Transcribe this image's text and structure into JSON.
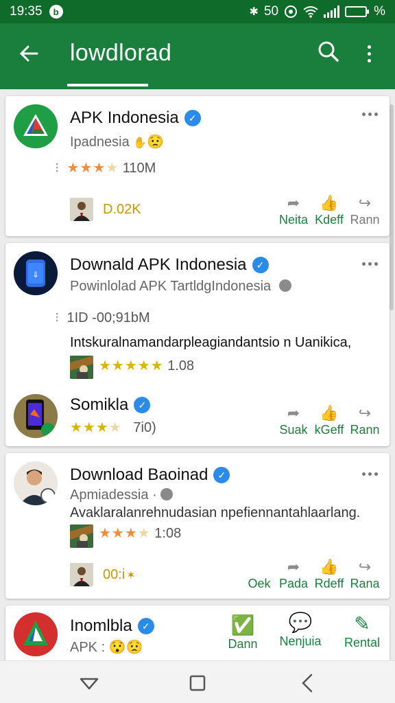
{
  "status": {
    "time": "19:35",
    "notif_icon": "b",
    "percent_num": "50",
    "battery": "%"
  },
  "appbar": {
    "title": "lowdlorad"
  },
  "cards": [
    {
      "name": "APK Indonesia",
      "sub": "Ipadnesia",
      "rating_text": "110M",
      "highlight": "D.02K",
      "actions": [
        "Neita",
        "Kdeff",
        "Rann"
      ]
    },
    {
      "name": "Downald APK Indonesia",
      "sub": "Powinlolad APK TartldgIndonesia",
      "meta": "1ID -00;91bM",
      "description": "Intskuralnamandarpleagiandantsio n Uanikica,",
      "rating_text": "1.08",
      "sub2_name": "Somikla",
      "sub2_rating": "7i0)",
      "actions": [
        "Suak",
        "kGeff",
        "Rann"
      ]
    },
    {
      "name": "Download Baoinad",
      "sub": "Apmiadessia",
      "description": "Avaklaralanrehnudasian npefiennantahlaarlang.",
      "rating_text": "1:08",
      "highlight": "00:i",
      "actions": [
        "Oek",
        "Pada",
        "Rdeff",
        "Rana"
      ]
    },
    {
      "name": "Inomlbla",
      "sub": "APK :",
      "actions": [
        "Dann",
        "Nenjuia",
        "Rental"
      ]
    }
  ],
  "colors": {
    "primary": "#1a7f3c",
    "statusbar": "#0f6b2a",
    "verified": "#2a8ce8",
    "star": "#f2b21c",
    "highlight": "#c99700"
  }
}
